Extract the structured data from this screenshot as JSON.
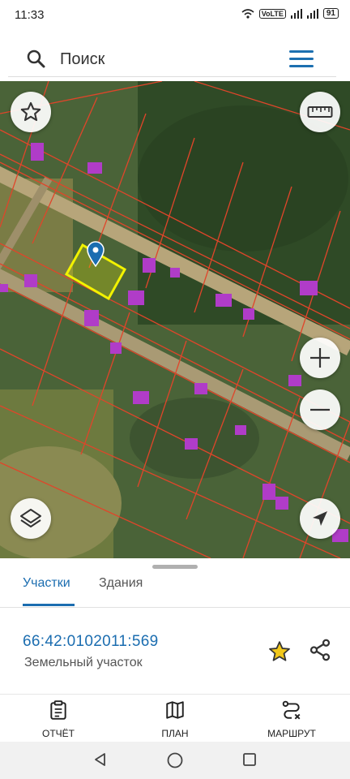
{
  "status_bar": {
    "time": "11:33",
    "network": "VoLTE",
    "battery": "91"
  },
  "search": {
    "placeholder": "Поиск"
  },
  "tabs": [
    {
      "label": "Участки",
      "active": true
    },
    {
      "label": "Здания",
      "active": false
    }
  ],
  "parcel": {
    "cadastral_number": "66:42:0102011:569",
    "type": "Земельный участок",
    "favorite": true
  },
  "toolbar": {
    "report_label": "ОТЧЁТ",
    "plan_label": "ПЛАН",
    "route_label": "МАРШРУТ"
  },
  "colors": {
    "accent": "#1b6db0",
    "selected_parcel": "#f2f200",
    "parcel_border": "#e0452a",
    "building": "#b03cc8",
    "favorite_star": "#f2c81a"
  },
  "icons": [
    "search-icon",
    "menu-icon",
    "star-icon",
    "ruler-icon",
    "layers-icon",
    "zoom-in-icon",
    "zoom-out-icon",
    "navigation-icon",
    "location-pin-icon",
    "share-icon",
    "clipboard-icon",
    "map-icon",
    "route-icon",
    "back-icon",
    "home-icon",
    "recents-icon"
  ]
}
